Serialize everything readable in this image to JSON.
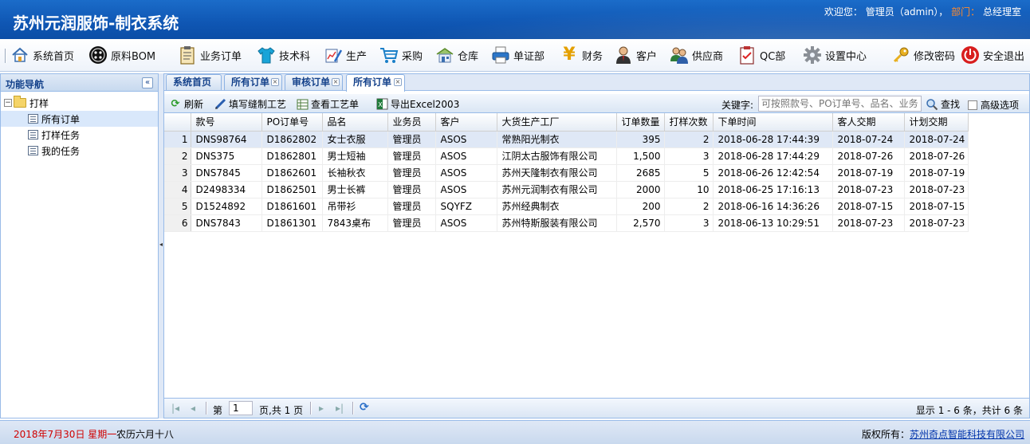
{
  "header": {
    "app_title": "苏州元润服饰-制衣系统",
    "welcome_prefix": "欢迎您：",
    "user": "管理员（admin），",
    "dept_label": "部门：",
    "dept": "总经理室"
  },
  "menu": [
    {
      "label": "系统首页",
      "icon": "home-icon"
    },
    {
      "label": "原料BOM",
      "icon": "button-icon"
    },
    {
      "label": "业务订单",
      "icon": "clipboard-icon"
    },
    {
      "label": "技术科",
      "icon": "shirt-icon"
    },
    {
      "label": "生产",
      "icon": "chart-pen-icon"
    },
    {
      "label": "采购",
      "icon": "cart-icon"
    },
    {
      "label": "仓库",
      "icon": "warehouse-icon"
    },
    {
      "label": "单证部",
      "icon": "printer-icon"
    },
    {
      "label": "财务",
      "icon": "yen-icon"
    },
    {
      "label": "客户",
      "icon": "person-icon"
    },
    {
      "label": "供应商",
      "icon": "people-icon"
    },
    {
      "label": "QC部",
      "icon": "checklist-icon"
    },
    {
      "label": "设置中心",
      "icon": "gear-icon"
    },
    {
      "label": "修改密码",
      "icon": "key-icon"
    },
    {
      "label": "安全退出",
      "icon": "power-icon"
    }
  ],
  "nav": {
    "title": "功能导航",
    "collapse_glyph": "«",
    "root": "打样",
    "items": [
      "所有订单",
      "打样任务",
      "我的任务"
    ]
  },
  "tabs": [
    "系统首页",
    "所有订单",
    "审核订单",
    "所有订单"
  ],
  "toolbar": {
    "refresh": "刷新",
    "fill_process": "填写缝制工艺",
    "view_process": "查看工艺单",
    "export": "导出Excel2003",
    "keyword_label": "关键字:",
    "keyword_placeholder": "可按照款号、PO订单号、品名、业务员",
    "search": "查找",
    "advanced": "高级选项"
  },
  "grid": {
    "columns": [
      "款号",
      "PO订单号",
      "品名",
      "业务员",
      "客户",
      "大货生产工厂",
      "订单数量",
      "打样次数",
      "下单时间",
      "客人交期",
      "计划交期"
    ],
    "rows": [
      [
        "1",
        "DNS98764",
        "D1862802",
        "女士衣服",
        "管理员",
        "ASOS",
        "常熟阳光制衣",
        "395",
        "2",
        "2018-06-28 17:44:39",
        "2018-07-24",
        "2018-07-24"
      ],
      [
        "2",
        "DNS375",
        "D1862801",
        "男士短袖",
        "管理员",
        "ASOS",
        "江阴太古服饰有限公司",
        "1,500",
        "3",
        "2018-06-28 17:44:29",
        "2018-07-26",
        "2018-07-26"
      ],
      [
        "3",
        "DNS7845",
        "D1862601",
        "长袖秋衣",
        "管理员",
        "ASOS",
        "苏州天隆制衣有限公司",
        "2685",
        "5",
        "2018-06-26 12:42:54",
        "2018-07-19",
        "2018-07-19"
      ],
      [
        "4",
        "D2498334",
        "D1862501",
        "男士长裤",
        "管理员",
        "ASOS",
        "苏州元润制衣有限公司",
        "2000",
        "10",
        "2018-06-25 17:16:13",
        "2018-07-23",
        "2018-07-23"
      ],
      [
        "5",
        "D1524892",
        "D1861601",
        "吊带衫",
        "管理员",
        "SQYFZ",
        "苏州经典制衣",
        "200",
        "2",
        "2018-06-16 14:36:26",
        "2018-07-15",
        "2018-07-15"
      ],
      [
        "6",
        "DNS7843",
        "D1861301",
        "7843桌布",
        "管理员",
        "ASOS",
        "苏州特斯服装有限公司",
        "2,570",
        "3",
        "2018-06-13 10:29:51",
        "2018-07-23",
        "2018-07-23"
      ]
    ]
  },
  "pager": {
    "page_label": "第",
    "page_value": "1",
    "page_total": "页,共 1 页",
    "summary": "显示 1 - 6 条，共计 6 条"
  },
  "footer": {
    "date": "2018年7月30日 星期一",
    "lunar": "农历六月十八",
    "copyright_prefix": "版权所有：",
    "company": "苏州奇点智能科技有限公司"
  },
  "colors": {
    "header_bg": "#1b6cc9",
    "dept_label": "#ff8a2b",
    "panel_border": "#99bbe8",
    "date_red": "#d00000",
    "selected_row": "#dfe8f6"
  }
}
